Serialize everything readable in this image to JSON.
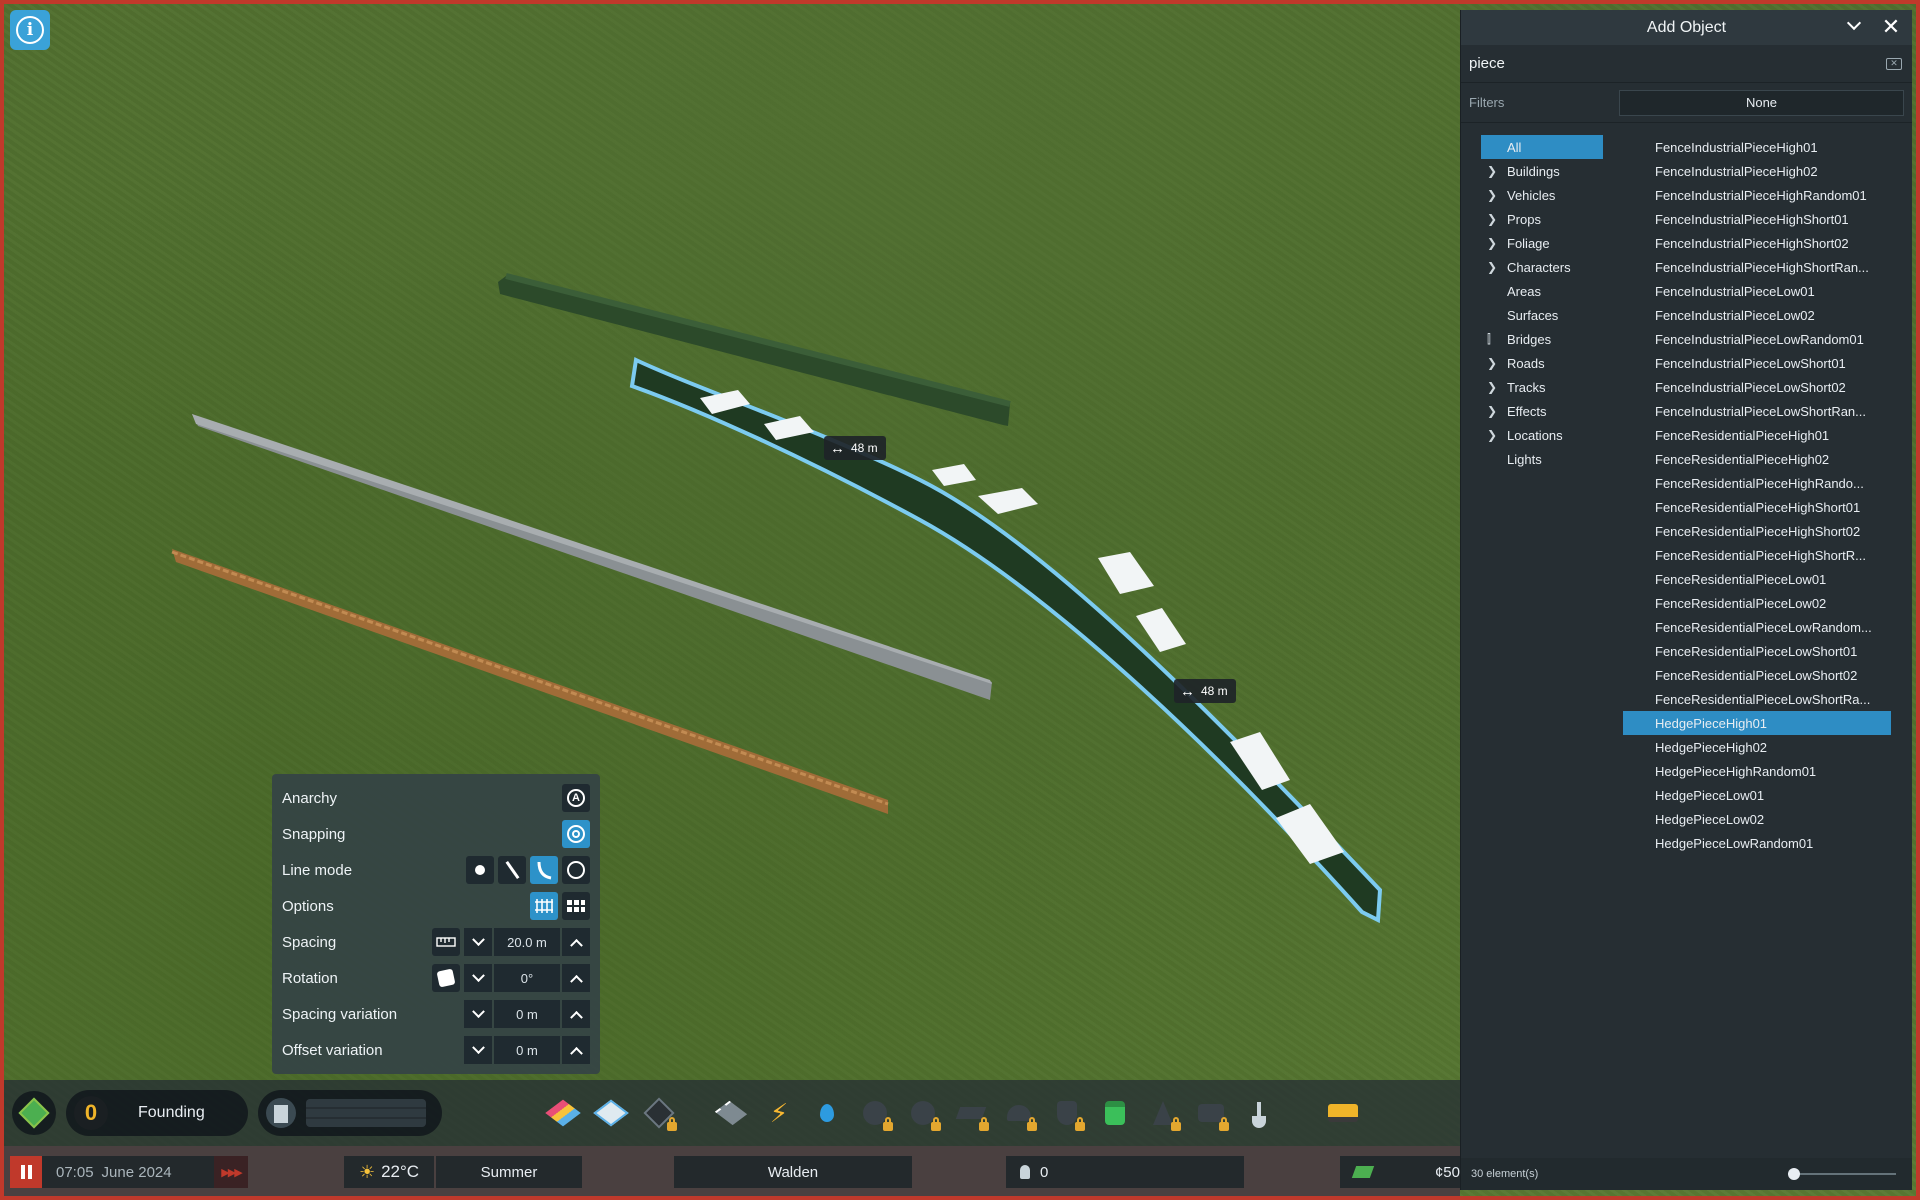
{
  "scene": {
    "measure_labels": [
      "48 m",
      "48 m"
    ]
  },
  "tool_panel": {
    "rows": {
      "anarchy": "Anarchy",
      "snapping": "Snapping",
      "line_mode": "Line mode",
      "options": "Options",
      "spacing": "Spacing",
      "rotation": "Rotation",
      "spacing_variation": "Spacing variation",
      "offset_variation": "Offset variation"
    },
    "values": {
      "spacing": "20.0 m",
      "rotation": "0°",
      "spacing_variation": "0 m",
      "offset_variation": "0 m"
    },
    "active_line_mode": "curve"
  },
  "add_object": {
    "title": "Add Object",
    "search_value": "piece",
    "filters_label": "Filters",
    "filters_value": "None",
    "categories": [
      {
        "label": "All",
        "expandable": false,
        "selected": true
      },
      {
        "label": "Buildings",
        "expandable": true
      },
      {
        "label": "Vehicles",
        "expandable": true
      },
      {
        "label": "Props",
        "expandable": true
      },
      {
        "label": "Foliage",
        "expandable": true
      },
      {
        "label": "Characters",
        "expandable": true
      },
      {
        "label": "Areas",
        "expandable": false
      },
      {
        "label": "Surfaces",
        "expandable": false
      },
      {
        "label": "Bridges",
        "expandable": false,
        "icon": "bridge-icon"
      },
      {
        "label": "Roads",
        "expandable": true
      },
      {
        "label": "Tracks",
        "expandable": true
      },
      {
        "label": "Effects",
        "expandable": true
      },
      {
        "label": "Locations",
        "expandable": true
      },
      {
        "label": "Lights",
        "expandable": false
      }
    ],
    "items": [
      "FenceIndustrialPieceHigh01",
      "FenceIndustrialPieceHigh02",
      "FenceIndustrialPieceHighRandom01",
      "FenceIndustrialPieceHighShort01",
      "FenceIndustrialPieceHighShort02",
      "FenceIndustrialPieceHighShortRan...",
      "FenceIndustrialPieceLow01",
      "FenceIndustrialPieceLow02",
      "FenceIndustrialPieceLowRandom01",
      "FenceIndustrialPieceLowShort01",
      "FenceIndustrialPieceLowShort02",
      "FenceIndustrialPieceLowShortRan...",
      "FenceResidentialPieceHigh01",
      "FenceResidentialPieceHigh02",
      "FenceResidentialPieceHighRando...",
      "FenceResidentialPieceHighShort01",
      "FenceResidentialPieceHighShort02",
      "FenceResidentialPieceHighShortR...",
      "FenceResidentialPieceLow01",
      "FenceResidentialPieceLow02",
      "FenceResidentialPieceLowRandom...",
      "FenceResidentialPieceLowShort01",
      "FenceResidentialPieceLowShort02",
      "FenceResidentialPieceLowShortRa...",
      "HedgePieceHigh01",
      "HedgePieceHigh02",
      "HedgePieceHighRandom01",
      "HedgePieceLow01",
      "HedgePieceLow02",
      "HedgePieceLowRandom01"
    ],
    "selected_item": "HedgePieceHigh01",
    "footer_count": "30 element(s)"
  },
  "toolbar": {
    "milestone_number": "0",
    "milestone_name": "Founding"
  },
  "statusbar": {
    "time": "07:05",
    "date": "June 2024",
    "temperature": "22°C",
    "season": "Summer",
    "city_name": "Walden",
    "population": "0",
    "money": "¢50"
  },
  "colors": {
    "accent": "#2e8dc4",
    "panel_bg": "#262e33",
    "lock": "#e3a72f",
    "grass": "#52702f",
    "selection_outline": "#7ccbf0"
  }
}
